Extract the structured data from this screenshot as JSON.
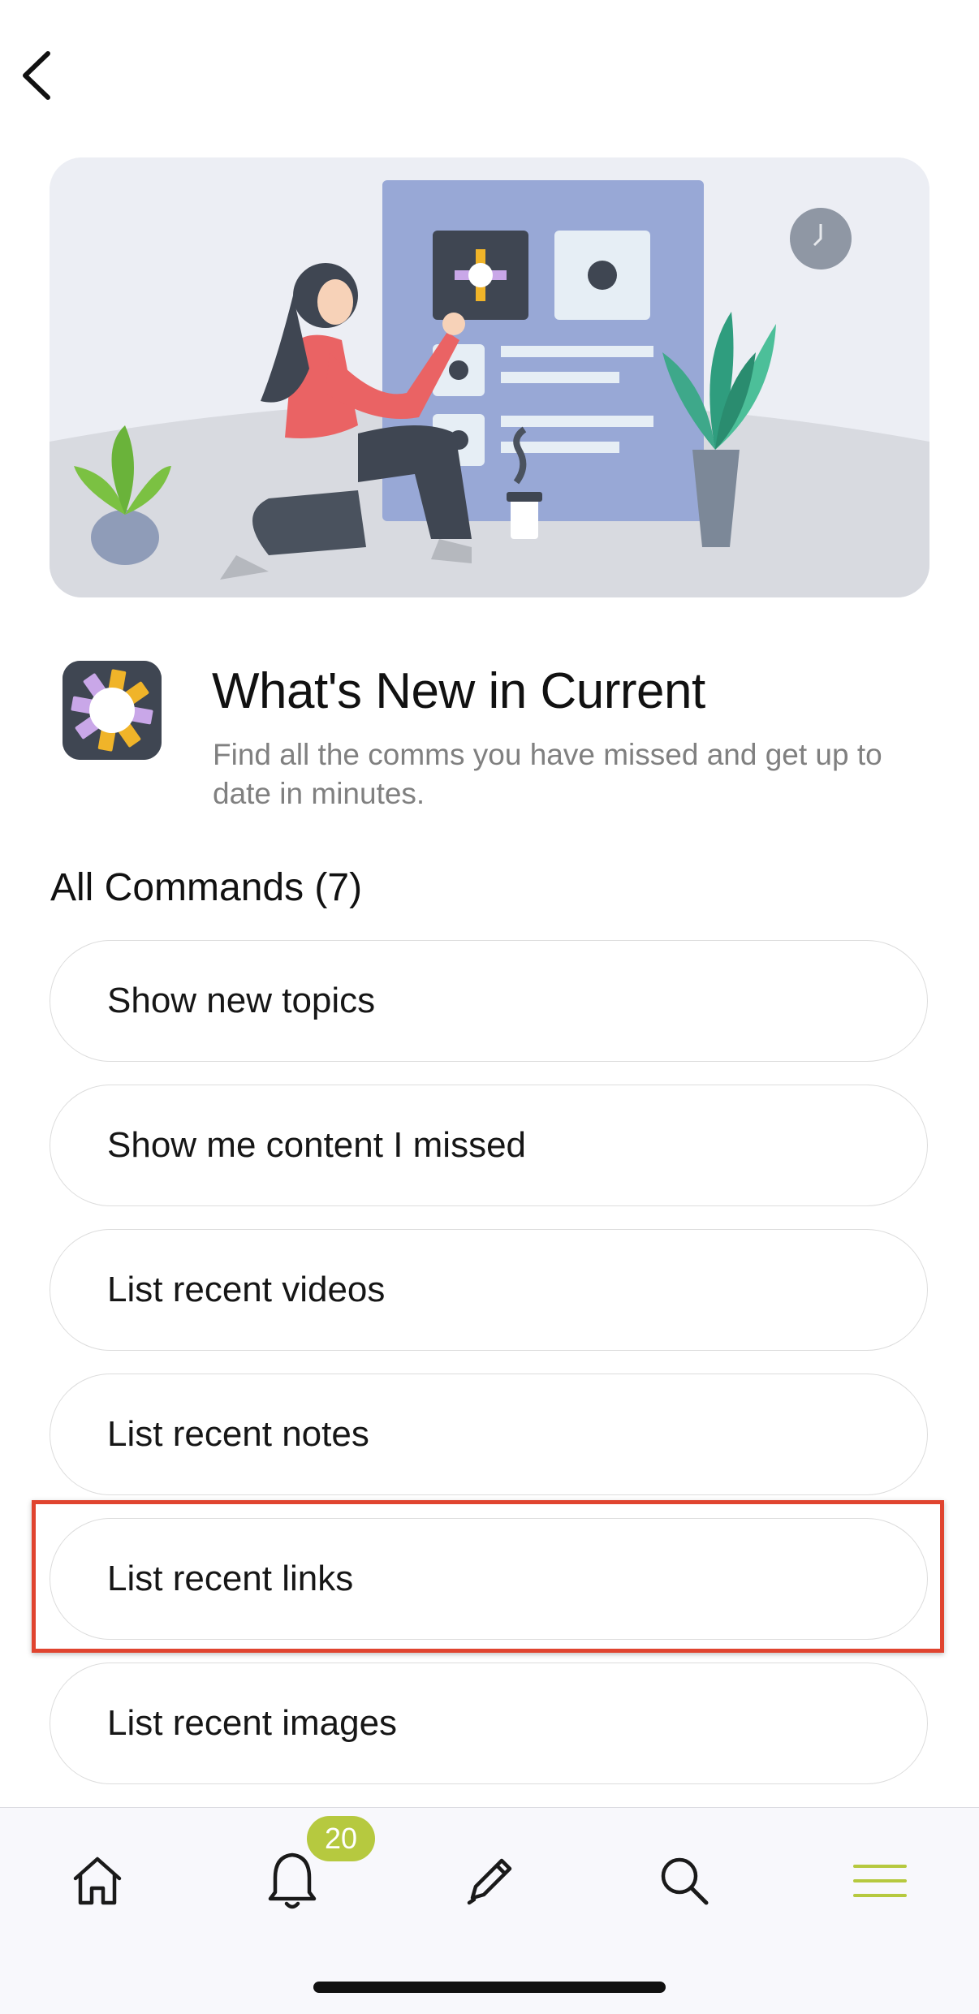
{
  "app": {
    "title": "What's New in Current",
    "description": "Find all the comms you have missed and get up to date in minutes."
  },
  "commands_section": {
    "title": "All Commands (7)"
  },
  "commands": [
    {
      "label": "Show new topics"
    },
    {
      "label": "Show me content I missed"
    },
    {
      "label": "List recent videos"
    },
    {
      "label": "List recent notes"
    },
    {
      "label": "List recent links",
      "highlighted": true
    },
    {
      "label": "List recent images"
    }
  ],
  "tabbar": {
    "notifications_badge": "20",
    "items": [
      "home-icon",
      "bell-icon",
      "pencil-icon",
      "search-icon",
      "menu-icon"
    ],
    "active_item": "menu-icon"
  },
  "colors": {
    "accent": "#b6c93f",
    "highlight_border": "#e0442f",
    "hero_background": "#eceef4",
    "board": "#98a8d6"
  }
}
